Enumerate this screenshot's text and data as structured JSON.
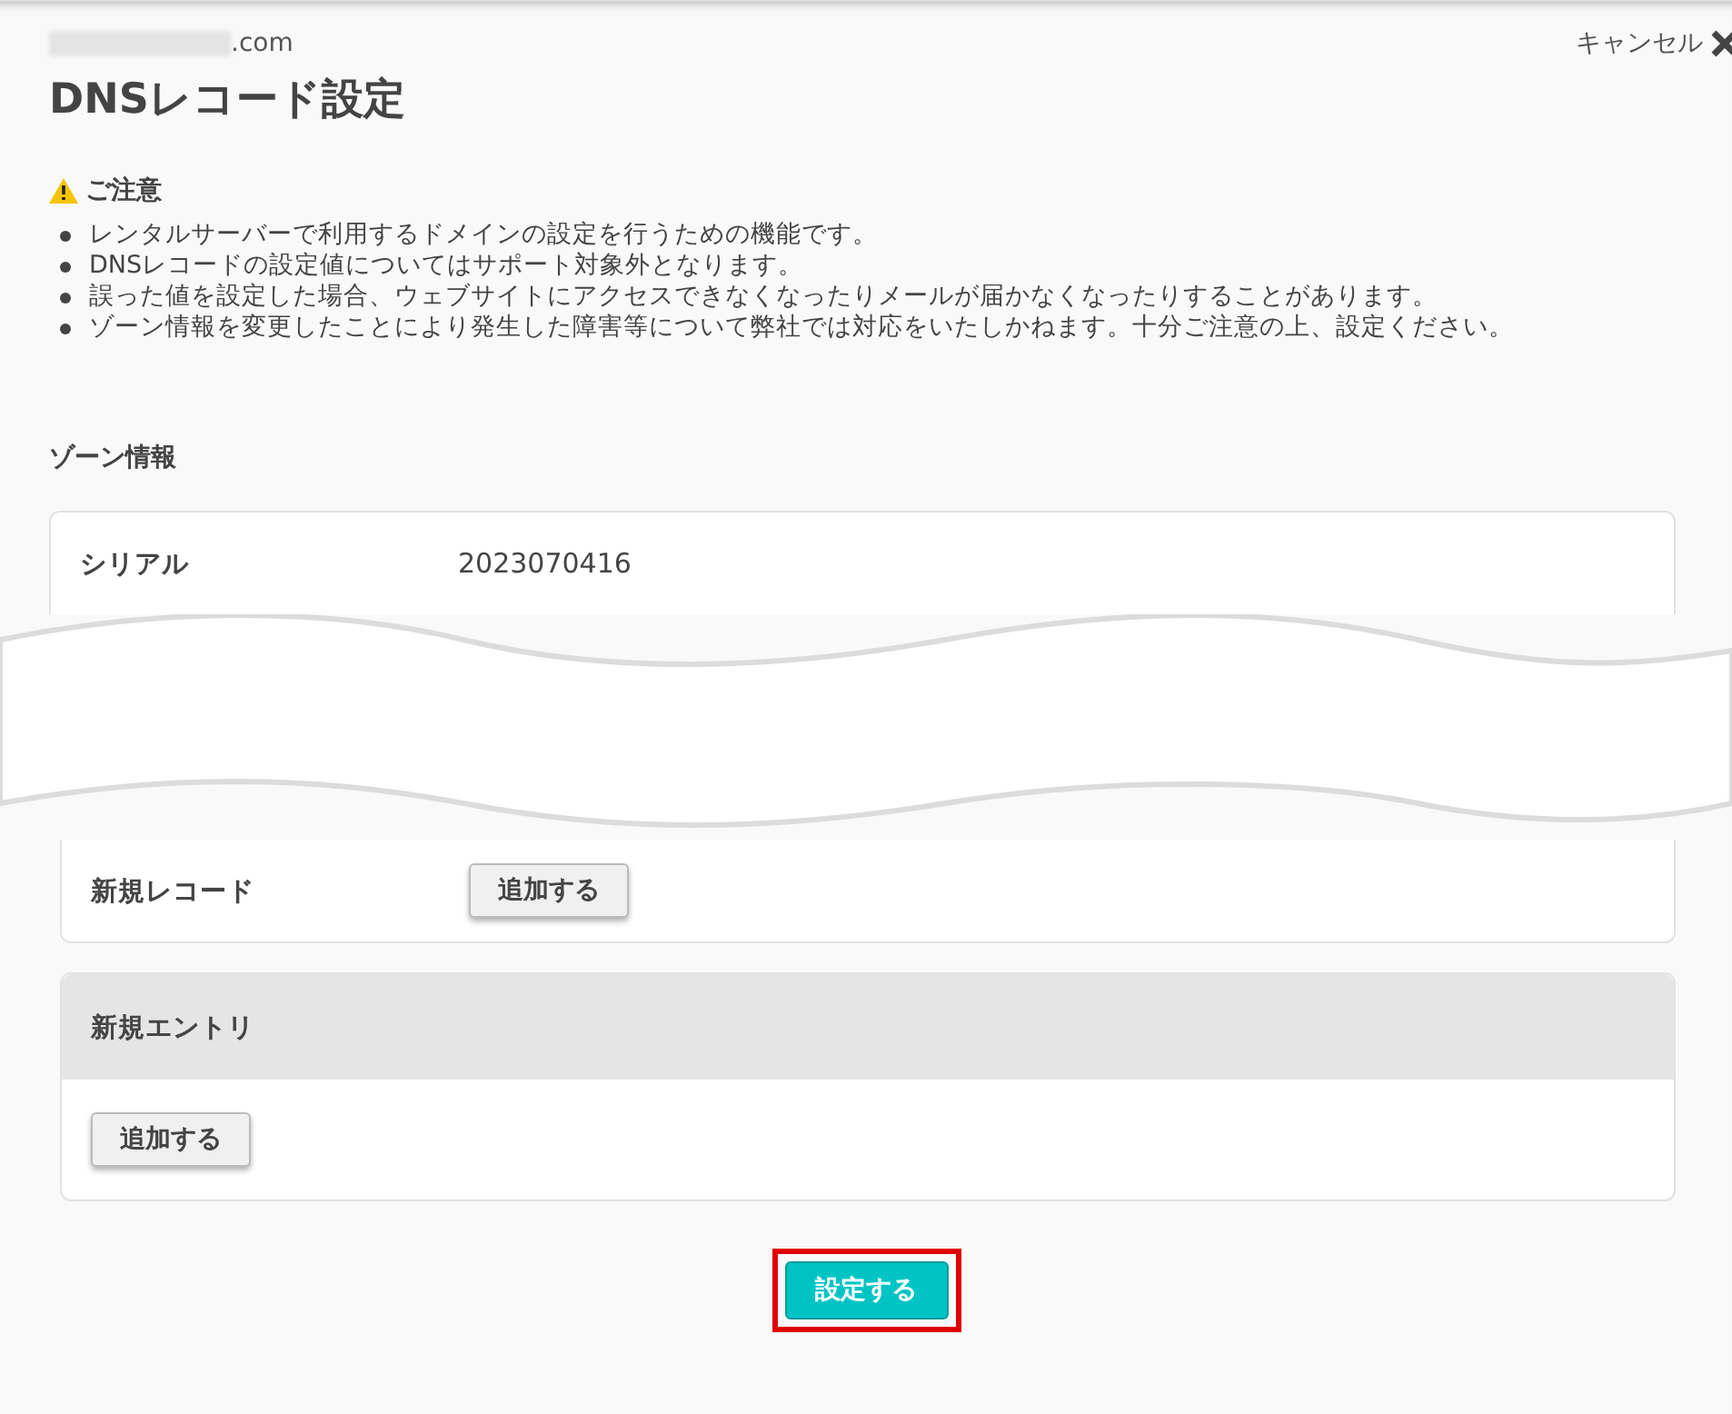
{
  "header": {
    "domain_suffix": ".com",
    "cancel": "キャンセル",
    "title": "DNSレコード設定"
  },
  "notice": {
    "heading": "ご注意",
    "items": [
      "レンタルサーバーで利用するドメインの設定を行うための機能です。",
      "DNSレコードの設定値についてはサポート対象外となります。",
      "誤った値を設定した場合、ウェブサイトにアクセスできなくなったりメールが届かなくなったりすることがあります。",
      "ゾーン情報を変更したことにより発生した障害等について弊社では対応をいたしかねます。十分ご注意の上、設定ください。"
    ]
  },
  "zone": {
    "heading": "ゾーン情報",
    "serial_label": "シリアル",
    "serial_value": "2023070416",
    "new_record_label": "新規レコード",
    "new_record_button": "追加する"
  },
  "new_entry": {
    "heading": "新規エントリ",
    "button": "追加する"
  },
  "submit": {
    "label": "設定する",
    "highlighted": true
  }
}
